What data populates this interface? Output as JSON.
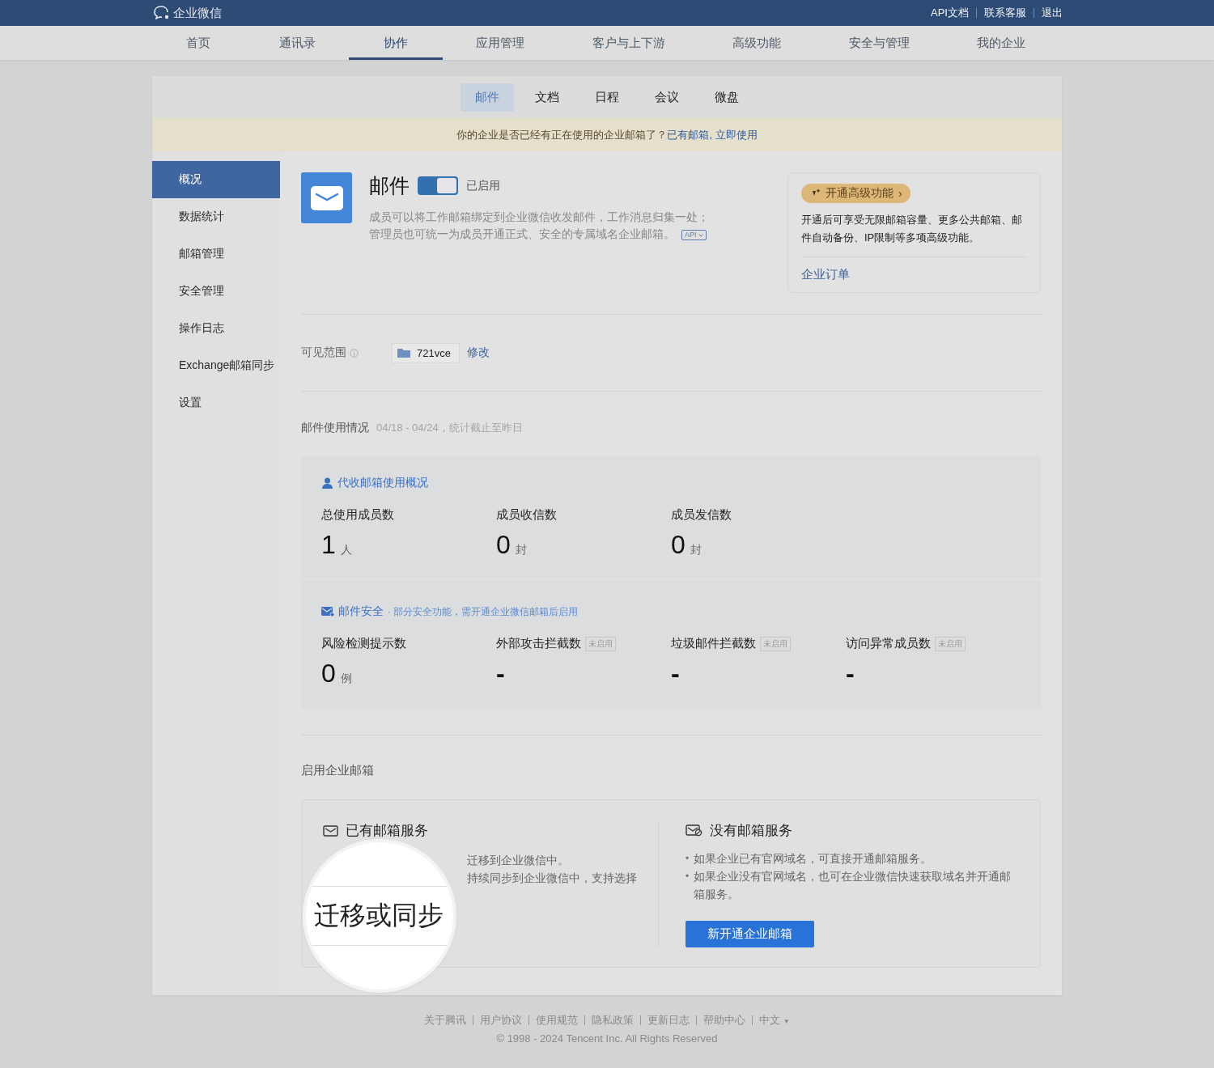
{
  "topbar": {
    "logo": "企业微信",
    "links": [
      "API文档",
      "联系客服",
      "退出"
    ]
  },
  "nav": [
    {
      "label": "首页",
      "selected": false
    },
    {
      "label": "通讯录",
      "selected": false
    },
    {
      "label": "协作",
      "selected": true
    },
    {
      "label": "应用管理",
      "selected": false
    },
    {
      "label": "客户与上下游",
      "selected": false
    },
    {
      "label": "高级功能",
      "selected": false
    },
    {
      "label": "安全与管理",
      "selected": false
    },
    {
      "label": "我的企业",
      "selected": false
    }
  ],
  "subtabs": [
    {
      "label": "邮件",
      "selected": true
    },
    {
      "label": "文档",
      "selected": false
    },
    {
      "label": "日程",
      "selected": false
    },
    {
      "label": "会议",
      "selected": false
    },
    {
      "label": "微盘",
      "selected": false
    }
  ],
  "notice": {
    "text": "你的企业是否已经有正在使用的企业邮箱了？",
    "link": "已有邮箱, 立即使用"
  },
  "sidebar": [
    {
      "label": "概况",
      "selected": true
    },
    {
      "label": "数据统计",
      "selected": false
    },
    {
      "label": "邮箱管理",
      "selected": false
    },
    {
      "label": "安全管理",
      "selected": false
    },
    {
      "label": "操作日志",
      "selected": false
    },
    {
      "label": "Exchange邮箱同步",
      "selected": false
    },
    {
      "label": "设置",
      "selected": false
    }
  ],
  "app": {
    "title": "邮件",
    "enabled": true,
    "status": "已启用",
    "description": [
      "成员可以将工作邮箱绑定到企业微信收发邮件，工作消息归集一处；",
      "管理员也可统一为成员开通正式、安全的专属域名企业邮箱。"
    ],
    "api_badge": "API"
  },
  "upgrade": {
    "badge": "开通高级功能",
    "badge_caret": "›",
    "text": "开通后可享受无限邮箱容量、更多公共邮箱、邮件自动备份、IP限制等多项高级功能。",
    "link": "企业订单"
  },
  "visibility": {
    "label": "可见范围",
    "department": "721vce",
    "edit": "修改"
  },
  "usage": {
    "title": "邮件使用情况",
    "period": "04/18 - 04/24，统计截止至昨日",
    "proxy": {
      "title": "代收邮箱使用概况",
      "stats": [
        {
          "label": "总使用成员数",
          "value": "1",
          "unit": "人"
        },
        {
          "label": "成员收信数",
          "value": "0",
          "unit": "封"
        },
        {
          "label": "成员发信数",
          "value": "0",
          "unit": "封"
        }
      ]
    },
    "security": {
      "title": "邮件安全",
      "note": "· 部分安全功能，需开通企业微信邮箱后启用",
      "stats": [
        {
          "label": "风险检测提示数",
          "value": "0",
          "unit": "例",
          "enabled": true
        },
        {
          "label": "外部攻击拦截数",
          "value": "-",
          "badge": "未启用",
          "enabled": false
        },
        {
          "label": "垃圾邮件拦截数",
          "value": "-",
          "badge": "未启用",
          "enabled": false
        },
        {
          "label": "访问异常成员数",
          "value": "-",
          "badge": "未启用",
          "enabled": false
        }
      ]
    }
  },
  "enable": {
    "title": "启用企业邮箱",
    "existing": {
      "title": "已有邮箱服务",
      "lines": [
        "迁移到企业微信中。",
        "持续同步到企业微信中，支持选择"
      ]
    },
    "magnifier": {
      "text": "迁移或同步"
    },
    "new": {
      "title": "没有邮箱服务",
      "marker": "•",
      "bullets": [
        "如果企业已有官网域名，可直接开通邮箱服务。",
        "如果企业没有官网域名，也可在企业微信快速获取域名并开通邮箱服务。"
      ],
      "button": "新开通企业邮箱"
    }
  },
  "footer": {
    "links": [
      "关于腾讯",
      "用户协议",
      "使用规范",
      "隐私政策",
      "更新日志",
      "帮助中心"
    ],
    "language": "中文",
    "caret": "▼",
    "copyright": "© 1998 - 2024 Tencent Inc. All Rights Reserved"
  }
}
